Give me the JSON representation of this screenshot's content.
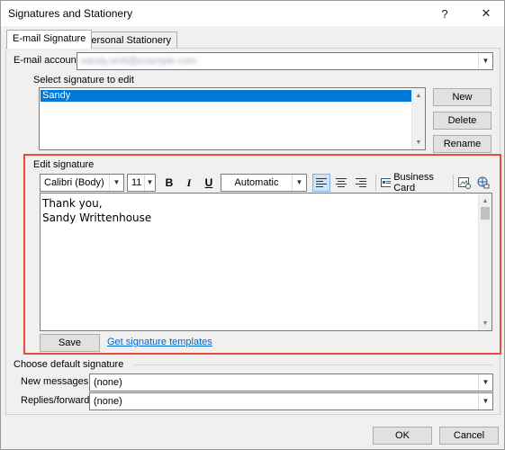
{
  "window": {
    "title": "Signatures and Stationery",
    "help_label": "?",
    "close_label": "✕"
  },
  "tabs": [
    {
      "label": "E-mail Signature",
      "active": true
    },
    {
      "label": "Personal Stationery",
      "active": false
    }
  ],
  "email_account": {
    "label": "E-mail account:",
    "value": "sandy.writt@example.com"
  },
  "select_signature": {
    "label": "Select signature to edit",
    "items": [
      "Sandy"
    ],
    "selected": "Sandy"
  },
  "side_buttons": {
    "new": "New",
    "delete": "Delete",
    "rename": "Rename"
  },
  "edit_signature": {
    "label": "Edit signature",
    "font": "Calibri (Body)",
    "size": "11",
    "bold": "B",
    "italic": "I",
    "underline": "U",
    "color": "Automatic",
    "business_card": "Business Card",
    "line1": "Thank you,",
    "line2": "Sandy Writtenhouse",
    "highlight_color": "#e64b3c"
  },
  "bottom_actions": {
    "save": "Save",
    "templates_link": "Get signature templates"
  },
  "defaults": {
    "heading": "Choose default signature",
    "new_messages_label": "New messages:",
    "new_messages_value": "(none)",
    "replies_label": "Replies/forwards:",
    "replies_value": "(none)"
  },
  "footer": {
    "ok": "OK",
    "cancel": "Cancel"
  }
}
